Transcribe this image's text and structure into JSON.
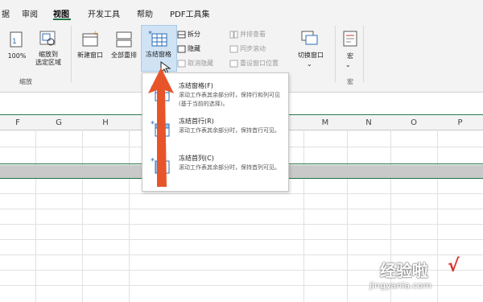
{
  "tabs": [
    "据",
    "审阅",
    "视图",
    "开发工具",
    "帮助",
    "PDF工具集"
  ],
  "ribbon": {
    "zoom_group": {
      "zoom100": "100%",
      "zoom_selection": "缩放到\n选定区域",
      "label": "缩放"
    },
    "window_group": {
      "new_window": "新建窗口",
      "arrange_all": "全部重排",
      "freeze_panes": "冻结窗格",
      "split": "拆分",
      "hide": "隐藏",
      "unhide": "取消隐藏",
      "side_by_side": "并排查看",
      "sync_scroll": "同步滚动",
      "reset_position": "重设窗口位置",
      "switch_window": "切换窗口"
    },
    "macro_group": {
      "macro": "宏",
      "label": "宏"
    }
  },
  "columns": [
    "F",
    "G",
    "H",
    "M",
    "N",
    "O",
    "P"
  ],
  "freeze_menu": [
    {
      "title": "冻结窗格(F)",
      "desc": "滚动工作表其余部分时，保持行和列可见(基于当前的选择)。"
    },
    {
      "title": "冻结首行(R)",
      "desc": "滚动工作表其余部分时，保持首行可见。"
    },
    {
      "title": "冻结首列(C)",
      "desc": "滚动工作表其余部分时，保持首列可见。"
    }
  ],
  "watermark": {
    "text": "经验啦",
    "url": "jingyanla.com",
    "check": "√"
  },
  "colors": {
    "accent": "#217346",
    "arrow": "#e8542a",
    "highlight": "#cfe3f5"
  }
}
